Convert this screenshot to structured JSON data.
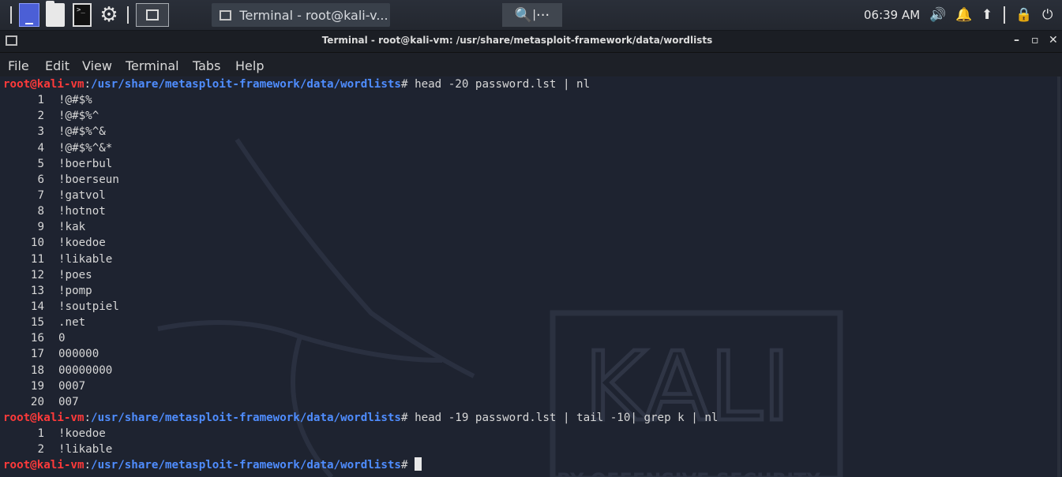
{
  "taskbar": {
    "task_title": "Terminal - root@kali-v...",
    "time": "06:39 AM"
  },
  "window": {
    "title": "Terminal - root@kali-vm: /usr/share/metasploit-framework/data/wordlists",
    "minimize": "–",
    "maximize": "▫",
    "close": "✕"
  },
  "menubar": {
    "items": [
      "File",
      "Edit",
      "View",
      "Terminal",
      "Tabs",
      "Help"
    ]
  },
  "terminal": {
    "prompt_user": "root@kali-vm",
    "prompt_path": "/usr/share/metasploit-framework/data/wordlists",
    "prompt_suffix": "# ",
    "command1": "head -20 password.lst | nl",
    "output1": [
      {
        "n": "1",
        "v": "!@#$%"
      },
      {
        "n": "2",
        "v": "!@#$%^"
      },
      {
        "n": "3",
        "v": "!@#$%^&"
      },
      {
        "n": "4",
        "v": "!@#$%^&*"
      },
      {
        "n": "5",
        "v": "!boerbul"
      },
      {
        "n": "6",
        "v": "!boerseun"
      },
      {
        "n": "7",
        "v": "!gatvol"
      },
      {
        "n": "8",
        "v": "!hotnot"
      },
      {
        "n": "9",
        "v": "!kak"
      },
      {
        "n": "10",
        "v": "!koedoe"
      },
      {
        "n": "11",
        "v": "!likable"
      },
      {
        "n": "12",
        "v": "!poes"
      },
      {
        "n": "13",
        "v": "!pomp"
      },
      {
        "n": "14",
        "v": "!soutpiel"
      },
      {
        "n": "15",
        "v": ".net"
      },
      {
        "n": "16",
        "v": "0"
      },
      {
        "n": "17",
        "v": "000000"
      },
      {
        "n": "18",
        "v": "00000000"
      },
      {
        "n": "19",
        "v": "0007"
      },
      {
        "n": "20",
        "v": "007"
      }
    ],
    "command2": "head -19 password.lst | tail -10| grep k | nl",
    "output2": [
      {
        "n": "1",
        "v": "!koedoe"
      },
      {
        "n": "2",
        "v": "!likable"
      }
    ]
  },
  "wallpaper": {
    "logo_text": "KALI",
    "tagline": "BY OFFENSIVE SECURITY"
  },
  "icons": {
    "launcher": [
      "app-menu-icon",
      "file-manager-icon",
      "terminal-icon",
      "settings-gear-icon"
    ],
    "tray": [
      "volume-icon",
      "notifications-bell-icon",
      "update-icon",
      "lock-icon",
      "power-icon"
    ]
  },
  "colors": {
    "prompt_user": "#ff3a3a",
    "prompt_path": "#4f8dff",
    "terminal_bg": "#1e2330"
  }
}
